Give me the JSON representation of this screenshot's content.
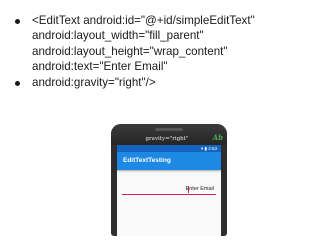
{
  "bullets": [
    {
      "lines": [
        "<EditText android:id=\"@+id/simpleEditText\"",
        "android:layout_width=\"fill_parent\"",
        "android:layout_height=\"wrap_content\"",
        "android:text=\"Enter Email\""
      ]
    },
    {
      "lines": [
        "android:gravity=\"right\"/>"
      ]
    }
  ],
  "screenshot": {
    "caption": "gravity=\"right\"",
    "brand": "Ab",
    "status_icons": "▾ ▮ 2:53",
    "app_title": "EditTextTesting",
    "edit_text_value": "Enter Email"
  },
  "colors": {
    "status_bar": "#1565c0",
    "app_bar": "#1e88e5",
    "accent_underline": "#d81b60"
  }
}
